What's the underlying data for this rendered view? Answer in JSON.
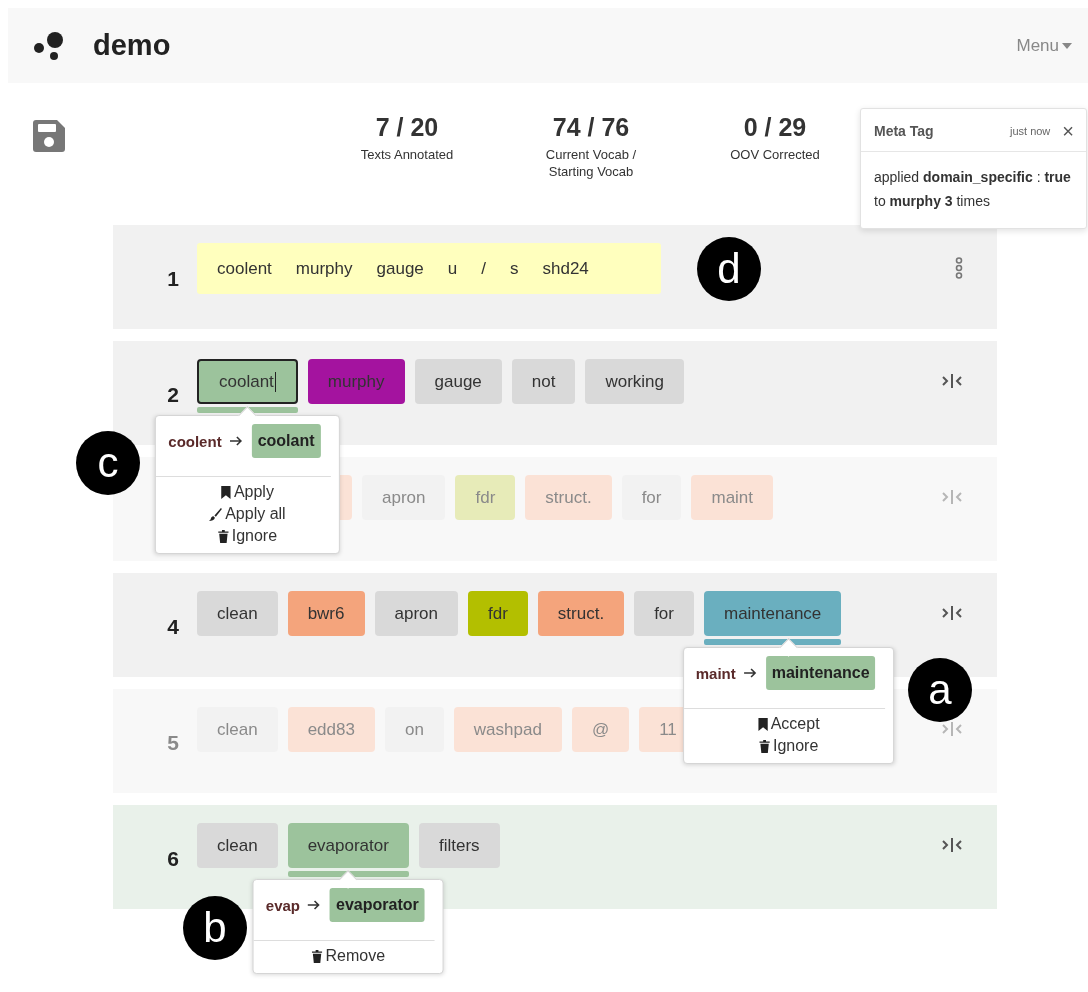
{
  "navbar": {
    "brand": "demo",
    "menu": "Menu"
  },
  "stats": [
    {
      "value": "7 / 20",
      "label": "Texts Annotated"
    },
    {
      "value": "74 / 76",
      "label": "Current Vocab / Starting Vocab"
    },
    {
      "value": "0 / 29",
      "label": "OOV Corrected"
    }
  ],
  "toast": {
    "title": "Meta Tag",
    "time": "just now",
    "close": "×",
    "message": "applied **domain_specific** : **true** to **murphy 3** times"
  },
  "texts": [
    {
      "number": "1",
      "kind": "raw",
      "tokens": [
        {
          "text": "coolent"
        },
        {
          "text": "murphy"
        },
        {
          "text": "gauge"
        },
        {
          "text": "u"
        },
        {
          "text": "/"
        },
        {
          "text": "s"
        },
        {
          "text": "shd24"
        }
      ]
    },
    {
      "number": "2",
      "kind": "normal",
      "tokens": [
        {
          "text": "coolant",
          "color": "#9cc39c",
          "editing": true,
          "underline": true,
          "popup": {
            "from": "coolent",
            "to": "coolant",
            "actions": [
              {
                "kind": "bookmark",
                "label": "Apply"
              },
              {
                "kind": "brush",
                "label": "Apply all"
              },
              {
                "kind": "trash",
                "label": "Ignore"
              }
            ]
          }
        },
        {
          "text": "murphy",
          "color": "#a4139f",
          "editing": false
        },
        {
          "text": "gauge",
          "color": "#d9d9d9",
          "editing": false
        },
        {
          "text": "not",
          "color": "#d9d9d9",
          "editing": false
        },
        {
          "text": "working",
          "color": "#d9d9d9",
          "editing": false
        }
      ]
    },
    {
      "kind": "faded",
      "tokens": [
        {
          "color": "#fbe2d6"
        },
        {
          "text": "apron",
          "color": "#f2f2f2"
        },
        {
          "text": "fdr",
          "color": "#e7ebb8"
        },
        {
          "text": "struct.",
          "color": "#fbe2d6"
        },
        {
          "text": "for",
          "color": "#f2f2f2"
        },
        {
          "text": "maint",
          "color": "#fbe2d6"
        }
      ]
    },
    {
      "number": "4",
      "kind": "normal",
      "tokens": [
        {
          "text": "clean",
          "color": "#d9d9d9"
        },
        {
          "text": "bwr6",
          "color": "#f4a47c"
        },
        {
          "text": "apron",
          "color": "#d9d9d9"
        },
        {
          "text": "fdr",
          "color": "#b3bf00"
        },
        {
          "text": "struct.",
          "color": "#f4a47c"
        },
        {
          "text": "for",
          "color": "#d9d9d9"
        },
        {
          "text": "maintenance",
          "color": "#6aafbf",
          "underline": true,
          "popup": {
            "from": "maint",
            "to": "maintenance",
            "actions": [
              {
                "kind": "bookmark",
                "label": "Accept"
              },
              {
                "kind": "trash",
                "label": "Ignore"
              }
            ]
          }
        }
      ]
    },
    {
      "number": "5",
      "kind": "faded",
      "tokens": [
        {
          "text": "clean",
          "color": "#f2f2f2"
        },
        {
          "text": "edd83",
          "color": "#fbe2d6"
        },
        {
          "text": "on",
          "color": "#f2f2f2"
        },
        {
          "text": "washpad",
          "color": "#fbe2d6"
        },
        {
          "text": "@",
          "color": "#fbe2d6"
        },
        {
          "text": "11",
          "color": "#fbe2d6"
        }
      ]
    },
    {
      "number": "6",
      "kind": "done",
      "tokens": [
        {
          "text": "clean",
          "color": "#d9d9d9"
        },
        {
          "text": "evaporator",
          "color": "#9cc39c",
          "underline": true,
          "popup": {
            "from": "evap",
            "to": "evaporator",
            "actions": [
              {
                "kind": "trash",
                "label": "Remove"
              }
            ]
          }
        },
        {
          "text": "filters",
          "color": "#d9d9d9"
        }
      ]
    }
  ],
  "callouts": [
    {
      "label": "d"
    },
    {
      "label": "c"
    },
    {
      "label": "a"
    },
    {
      "label": "b"
    }
  ]
}
